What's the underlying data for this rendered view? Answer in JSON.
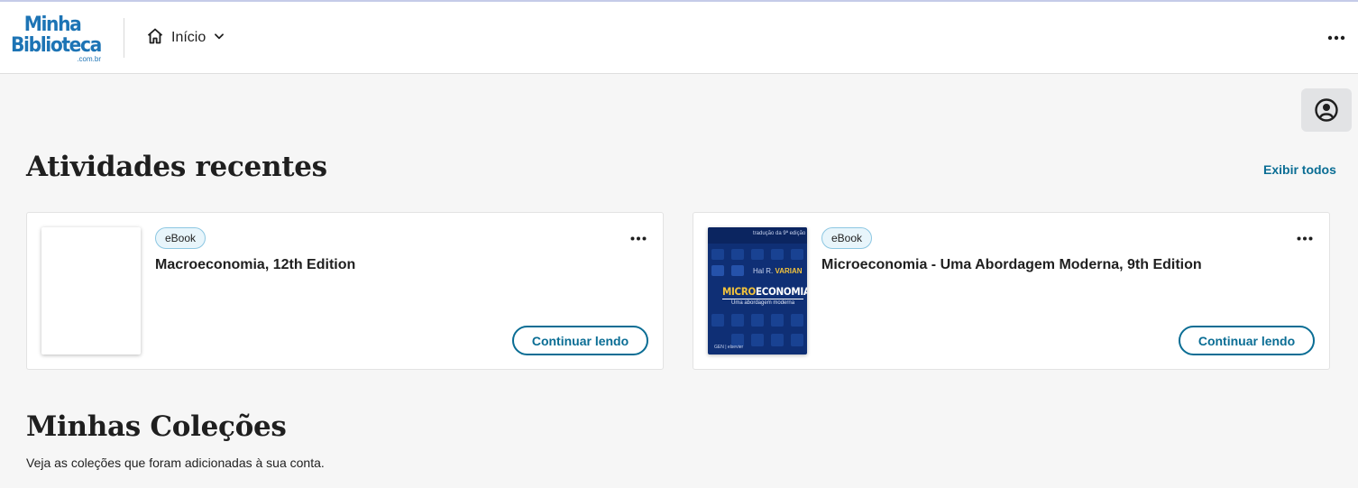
{
  "header": {
    "logo": {
      "line1": "Minha",
      "line2": "Biblioteca",
      "line3": ".com.br"
    },
    "nav": {
      "label": "Início",
      "icon": "home-icon"
    },
    "more_icon": "more-horizontal-icon"
  },
  "profile": {
    "icon": "user-circle-icon"
  },
  "recent": {
    "title": "Atividades recentes",
    "see_all": "Exibir todos",
    "cards": [
      {
        "badge": "eBook",
        "title": "Macroeconomia, 12th Edition",
        "button": "Continuar lendo"
      },
      {
        "badge": "eBook",
        "title": "Microeconomia - Uma Abordagem Moderna, 9th Edition",
        "button": "Continuar lendo",
        "cover": {
          "edition_note": "tradução da 9ª edição",
          "author_initials": "Hal R.",
          "author": "VARIAN",
          "title_highlight": "MICRO",
          "title_rest": "ECONOMIA",
          "subtitle": "Uma abordagem moderna",
          "publisher": "GEN | elsevier"
        }
      }
    ]
  },
  "collections": {
    "title": "Minhas Coleções",
    "description": "Veja as coleções que foram adicionadas à sua conta."
  },
  "colors": {
    "accent": "#0a6d94",
    "logo": "#1d74b5",
    "background": "#f6f6f6",
    "cover_blue": "#0f2f75",
    "cover_yellow": "#f3c33c"
  }
}
